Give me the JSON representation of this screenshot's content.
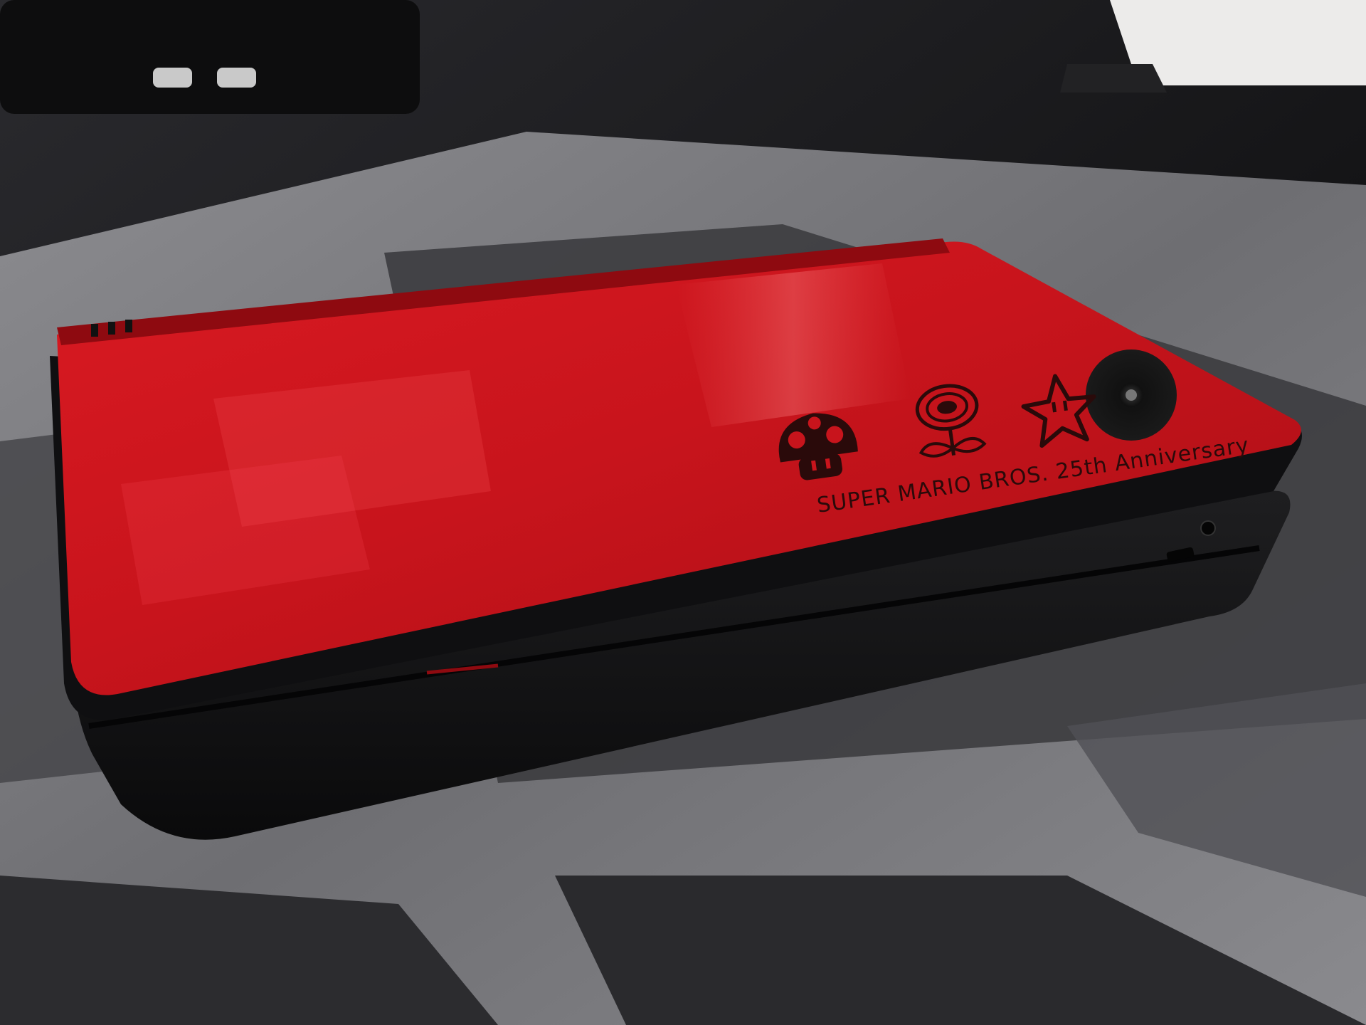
{
  "scene": {
    "subject": "handheld game console (closed)",
    "engraving_text": "SUPER MARIO BROS. 25th Anniversary",
    "engraving_icons": [
      "mushroom-icon",
      "fire-flower-icon",
      "star-icon"
    ],
    "colors": {
      "shell_red": "#c8141c",
      "shell_red_dark": "#8e0a10",
      "body_black": "#121214",
      "desk_black": "#1c1c1f",
      "mat_gray": "#7b7b7f",
      "mat_dark": "#3a3a3d",
      "engraving": "#2a0a0a"
    }
  }
}
